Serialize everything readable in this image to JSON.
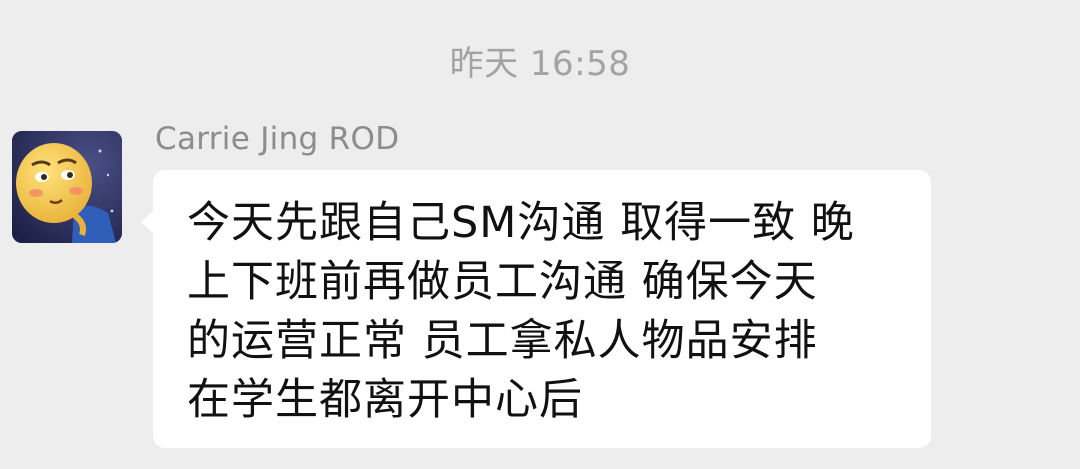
{
  "chat": {
    "timestamp": "昨天 16:58",
    "messages": [
      {
        "sender": "Carrie Jing ROD",
        "avatar_icon": "cartoon-face-avatar",
        "text": "今天先跟自己SM沟通 取得一致 晚\n上下班前再做员工沟通 确保今天\n的运营正常 员工拿私人物品安排\n在学生都离开中心后"
      }
    ]
  },
  "colors": {
    "background": "#ededed",
    "bubble": "#ffffff",
    "timestamp_text": "#a3a3a3",
    "sender_text": "#8c8c8c",
    "message_text": "#111111"
  }
}
